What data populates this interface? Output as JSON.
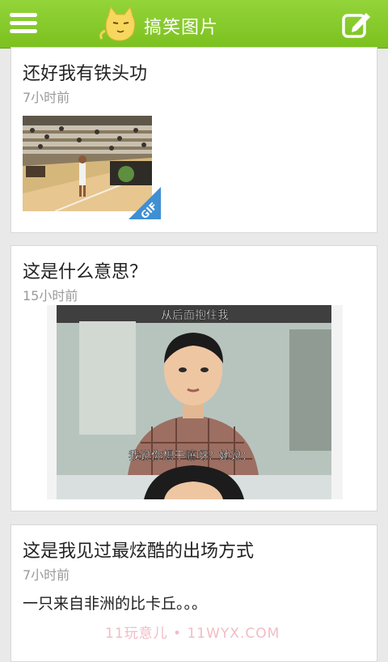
{
  "header": {
    "title": "搞笑图片",
    "menu_icon": "hamburger-menu-icon",
    "compose_icon": "edit-icon",
    "accent_color": "#86c92a"
  },
  "posts": [
    {
      "title": "还好我有铁头功",
      "time": "7小时前",
      "media": "gif",
      "badge": "GIF"
    },
    {
      "title": "这是什么意思？",
      "time": "15小时前",
      "media": "image",
      "caption_top": "从后面抱住我",
      "caption_bottom": "我说你想干嘛呀？她说："
    },
    {
      "title": "这是我见过最炫酷的出场方式",
      "time": "7小时前",
      "text": "一只来自非洲的比卡丘。。。"
    }
  ],
  "watermark": "11玩意儿 • 11WYX.COM"
}
